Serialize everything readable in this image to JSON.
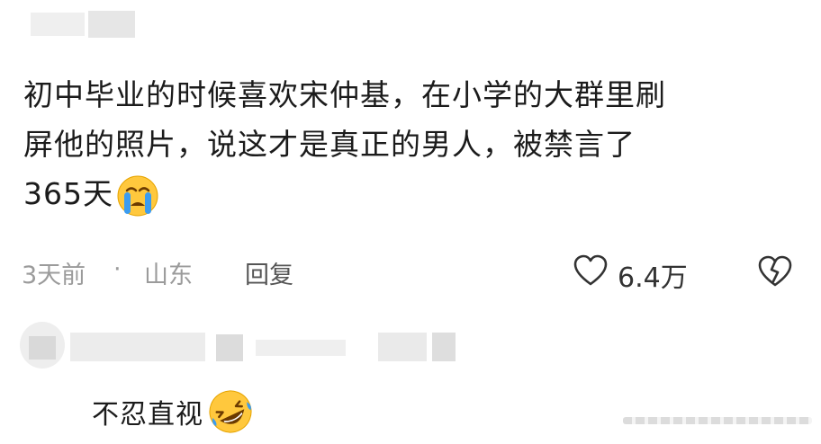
{
  "comment": {
    "lines": [
      "初中毕业的时候喜欢宋仲基，在小学的大群里刷",
      "屏他的照片，说这才是真正的男人，被禁言了",
      "365天"
    ],
    "emoji": "crying-face-icon"
  },
  "meta": {
    "time": "3天前",
    "dot": "·",
    "location": "山东",
    "reply_label": "回复",
    "likes": "6.4万"
  },
  "reply": {
    "text": "不忍直视",
    "emoji": "rolling-on-floor-laughing-icon"
  },
  "colors": {
    "text": "#1b1b1b",
    "meta": "#9b9b9b",
    "emoji_yellow": "#ffc83d",
    "tear_blue": "#3b9cf0"
  }
}
